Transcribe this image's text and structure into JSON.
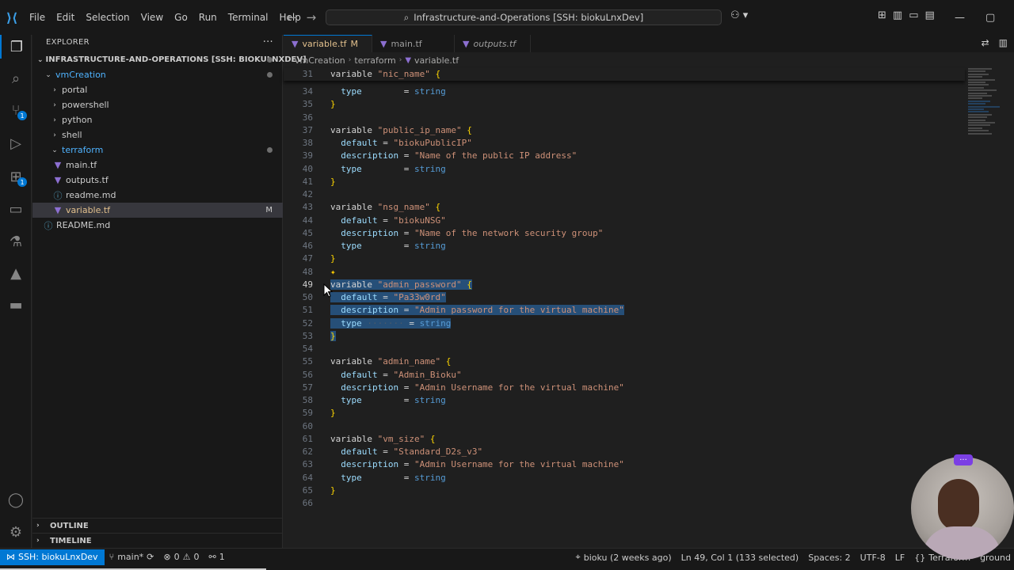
{
  "titlebar": {
    "menu": [
      "File",
      "Edit",
      "Selection",
      "View",
      "Go",
      "Run",
      "Terminal",
      "Help"
    ],
    "search_text": "Infrastructure-and-Operations [SSH: biokuLnxDev]"
  },
  "explorer": {
    "header": "EXPLORER",
    "root": "INFRASTRUCTURE-AND-OPERATIONS [SSH: BIOKULNXDEV]",
    "items": [
      {
        "label": "vmCreation",
        "type": "folder-open"
      },
      {
        "label": "portal",
        "type": "folder"
      },
      {
        "label": "powershell",
        "type": "folder"
      },
      {
        "label": "python",
        "type": "folder"
      },
      {
        "label": "shell",
        "type": "folder"
      },
      {
        "label": "terraform",
        "type": "folder-open"
      },
      {
        "label": "main.tf",
        "type": "tf"
      },
      {
        "label": "outputs.tf",
        "type": "tf"
      },
      {
        "label": "readme.md",
        "type": "info"
      },
      {
        "label": "variable.tf",
        "type": "tf",
        "git": "M"
      },
      {
        "label": "README.md",
        "type": "info"
      }
    ],
    "outline": "OUTLINE",
    "timeline": "TIMELINE"
  },
  "tabs": [
    {
      "label": "variable.tf",
      "badge": "M",
      "active": true
    },
    {
      "label": "main.tf",
      "active": false
    },
    {
      "label": "outputs.tf",
      "active": false
    }
  ],
  "breadcrumb": [
    "vmCreation",
    "terraform",
    "variable.tf"
  ],
  "code": {
    "sticky": {
      "num": "31",
      "parts": [
        [
          "kw",
          "variable "
        ],
        [
          "str",
          "\"nic_name\""
        ],
        [
          "kw",
          " "
        ],
        [
          "brace",
          "{"
        ]
      ]
    },
    "lines": [
      {
        "num": "34",
        "parts": [
          [
            "attr",
            "  type"
          ],
          [
            "eq",
            "        = "
          ],
          [
            "type",
            "string"
          ]
        ]
      },
      {
        "num": "35",
        "parts": [
          [
            "brace",
            "}"
          ]
        ]
      },
      {
        "num": "36",
        "parts": []
      },
      {
        "num": "37",
        "parts": [
          [
            "kw",
            "variable "
          ],
          [
            "str",
            "\"public_ip_name\""
          ],
          [
            "kw",
            " "
          ],
          [
            "brace",
            "{"
          ]
        ]
      },
      {
        "num": "38",
        "parts": [
          [
            "attr",
            "  default"
          ],
          [
            "eq",
            " = "
          ],
          [
            "str",
            "\"biokuPublicIP\""
          ]
        ]
      },
      {
        "num": "39",
        "parts": [
          [
            "attr",
            "  description"
          ],
          [
            "eq",
            " = "
          ],
          [
            "str",
            "\"Name of the public IP address\""
          ]
        ]
      },
      {
        "num": "40",
        "parts": [
          [
            "attr",
            "  type"
          ],
          [
            "eq",
            "        = "
          ],
          [
            "type",
            "string"
          ]
        ]
      },
      {
        "num": "41",
        "parts": [
          [
            "brace",
            "}"
          ]
        ]
      },
      {
        "num": "42",
        "parts": []
      },
      {
        "num": "43",
        "parts": [
          [
            "kw",
            "variable "
          ],
          [
            "str",
            "\"nsg_name\""
          ],
          [
            "kw",
            " "
          ],
          [
            "brace",
            "{"
          ]
        ]
      },
      {
        "num": "44",
        "parts": [
          [
            "attr",
            "  default"
          ],
          [
            "eq",
            " = "
          ],
          [
            "str",
            "\"biokuNSG\""
          ]
        ]
      },
      {
        "num": "45",
        "parts": [
          [
            "attr",
            "  description"
          ],
          [
            "eq",
            " = "
          ],
          [
            "str",
            "\"Name of the network security group\""
          ]
        ]
      },
      {
        "num": "46",
        "parts": [
          [
            "attr",
            "  type"
          ],
          [
            "eq",
            "        = "
          ],
          [
            "type",
            "string"
          ]
        ]
      },
      {
        "num": "47",
        "parts": [
          [
            "brace",
            "}"
          ]
        ]
      },
      {
        "num": "48",
        "parts": []
      },
      {
        "num": "49",
        "parts": [
          [
            "kw",
            "variable "
          ],
          [
            "str",
            "\"admin_password\""
          ],
          [
            "kw",
            " "
          ],
          [
            "brace",
            "{"
          ]
        ],
        "sel": true,
        "current": true
      },
      {
        "num": "50",
        "parts": [
          [
            "attr",
            "  default"
          ],
          [
            "eq",
            " = "
          ],
          [
            "str",
            "\"Pa33w0rd\""
          ]
        ],
        "sel": true
      },
      {
        "num": "51",
        "parts": [
          [
            "attr",
            "  description"
          ],
          [
            "eq",
            " = "
          ],
          [
            "str",
            "\"Admin password for the virtual machine\""
          ]
        ],
        "sel": true
      },
      {
        "num": "52",
        "parts": [
          [
            "attr",
            "  type"
          ],
          [
            "whitespace",
            " ·······"
          ],
          [
            "eq",
            " = "
          ],
          [
            "type",
            "string"
          ]
        ],
        "sel": true
      },
      {
        "num": "53",
        "parts": [
          [
            "brace",
            "}"
          ]
        ],
        "sel": true
      },
      {
        "num": "54",
        "parts": []
      },
      {
        "num": "55",
        "parts": [
          [
            "kw",
            "variable "
          ],
          [
            "str",
            "\"admin_name\""
          ],
          [
            "kw",
            " "
          ],
          [
            "brace",
            "{"
          ]
        ]
      },
      {
        "num": "56",
        "parts": [
          [
            "attr",
            "  default"
          ],
          [
            "eq",
            " = "
          ],
          [
            "str",
            "\"Admin_Bioku\""
          ]
        ]
      },
      {
        "num": "57",
        "parts": [
          [
            "attr",
            "  description"
          ],
          [
            "eq",
            " = "
          ],
          [
            "str",
            "\"Admin Username for the virtual machine\""
          ]
        ]
      },
      {
        "num": "58",
        "parts": [
          [
            "attr",
            "  type"
          ],
          [
            "eq",
            "        = "
          ],
          [
            "type",
            "string"
          ]
        ]
      },
      {
        "num": "59",
        "parts": [
          [
            "brace",
            "}"
          ]
        ]
      },
      {
        "num": "60",
        "parts": []
      },
      {
        "num": "61",
        "parts": [
          [
            "kw",
            "variable "
          ],
          [
            "str",
            "\"vm_size\""
          ],
          [
            "kw",
            " "
          ],
          [
            "brace",
            "{"
          ]
        ]
      },
      {
        "num": "62",
        "parts": [
          [
            "attr",
            "  default"
          ],
          [
            "eq",
            " = "
          ],
          [
            "str",
            "\"Standard_D2s_v3\""
          ]
        ]
      },
      {
        "num": "63",
        "parts": [
          [
            "attr",
            "  description"
          ],
          [
            "eq",
            " = "
          ],
          [
            "str",
            "\"Admin Username for the virtual machine\""
          ]
        ]
      },
      {
        "num": "64",
        "parts": [
          [
            "attr",
            "  type"
          ],
          [
            "eq",
            "        = "
          ],
          [
            "type",
            "string"
          ]
        ]
      },
      {
        "num": "65",
        "parts": [
          [
            "brace",
            "}"
          ]
        ]
      },
      {
        "num": "66",
        "parts": []
      }
    ]
  },
  "statusbar": {
    "remote": "SSH: biokuLnxDev",
    "branch": "main*",
    "errors": "0",
    "warnings": "0",
    "ports": "1",
    "blame": "bioku (2 weeks ago)",
    "position": "Ln 49, Col 1 (133 selected)",
    "spaces": "Spaces: 2",
    "encoding": "UTF-8",
    "eol": "LF",
    "language": "Terraform",
    "extra": "ground"
  },
  "colors": {
    "accent": "#0078d4",
    "selection": "#264f78",
    "string": "#ce9178",
    "terraform_icon": "#8c6fd1"
  }
}
